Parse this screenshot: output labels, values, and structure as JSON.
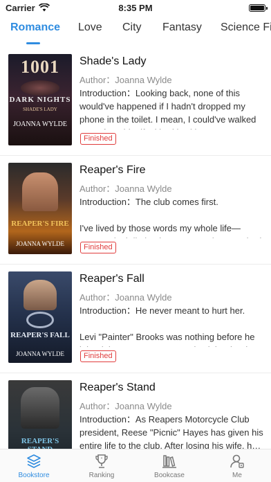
{
  "status_bar": {
    "carrier": "Carrier",
    "time": "8:35 PM",
    "battery_level": 1.0
  },
  "tabs": [
    {
      "label": "Romance",
      "active": true
    },
    {
      "label": "Love",
      "active": false
    },
    {
      "label": "City",
      "active": false
    },
    {
      "label": "Fantasy",
      "active": false
    },
    {
      "label": "Science Fi",
      "active": false
    }
  ],
  "books": [
    {
      "title": "Shade's Lady",
      "author": "Author：Joanna Wylde",
      "intro": "Introduction：Looking back, none of this would've happened if I hadn't dropped my phone in the toilet. I mean, I could've walked away from him if I'd had it with me.",
      "status": "Finished",
      "cover": {
        "number": "1001",
        "series": "DARK NIGHTS",
        "title": "SHADE'S LADY",
        "author": "JOANNA WYLDE"
      }
    },
    {
      "title": "Reaper's Fire",
      "author": "Author：Joanna Wylde",
      "intro": "Introduction：The club comes first.\n\nI've lived by those words my whole life—assumed I'd die by them, too, and I never had a…",
      "status": "Finished",
      "cover": {
        "title": "REAPER'S FIRE",
        "author": "JOANNA WYLDE"
      }
    },
    {
      "title": "Reaper's Fall",
      "author": "Author：Joanna Wylde",
      "intro": "Introduction：He never meant to hurt her.\n\nLevi \"Painter\" Brooks was nothing before he joined the Reapers motorcycle club. The day he…",
      "status": "Finished",
      "cover": {
        "title": "REAPER'S FALL",
        "author": "JOANNA WYLDE"
      }
    },
    {
      "title": "Reaper's Stand",
      "author": "Author：Joanna Wylde",
      "intro": "Introduction：As Reapers Motorcycle Club president, Reese \"Picnic\" Hayes has given his entire life to the club. After losing his wife, h…",
      "status": "",
      "cover": {
        "title": "REAPER'S STAND",
        "author": ""
      }
    }
  ],
  "bottom_nav": [
    {
      "label": "Bookstore",
      "icon": "bookstore-icon",
      "active": true
    },
    {
      "label": "Ranking",
      "icon": "trophy-icon",
      "active": false
    },
    {
      "label": "Bookcase",
      "icon": "bookcase-icon",
      "active": false
    },
    {
      "label": "Me",
      "icon": "profile-icon",
      "active": false
    }
  ],
  "colors": {
    "accent": "#2f8ce0",
    "badge": "#e03b3b"
  }
}
